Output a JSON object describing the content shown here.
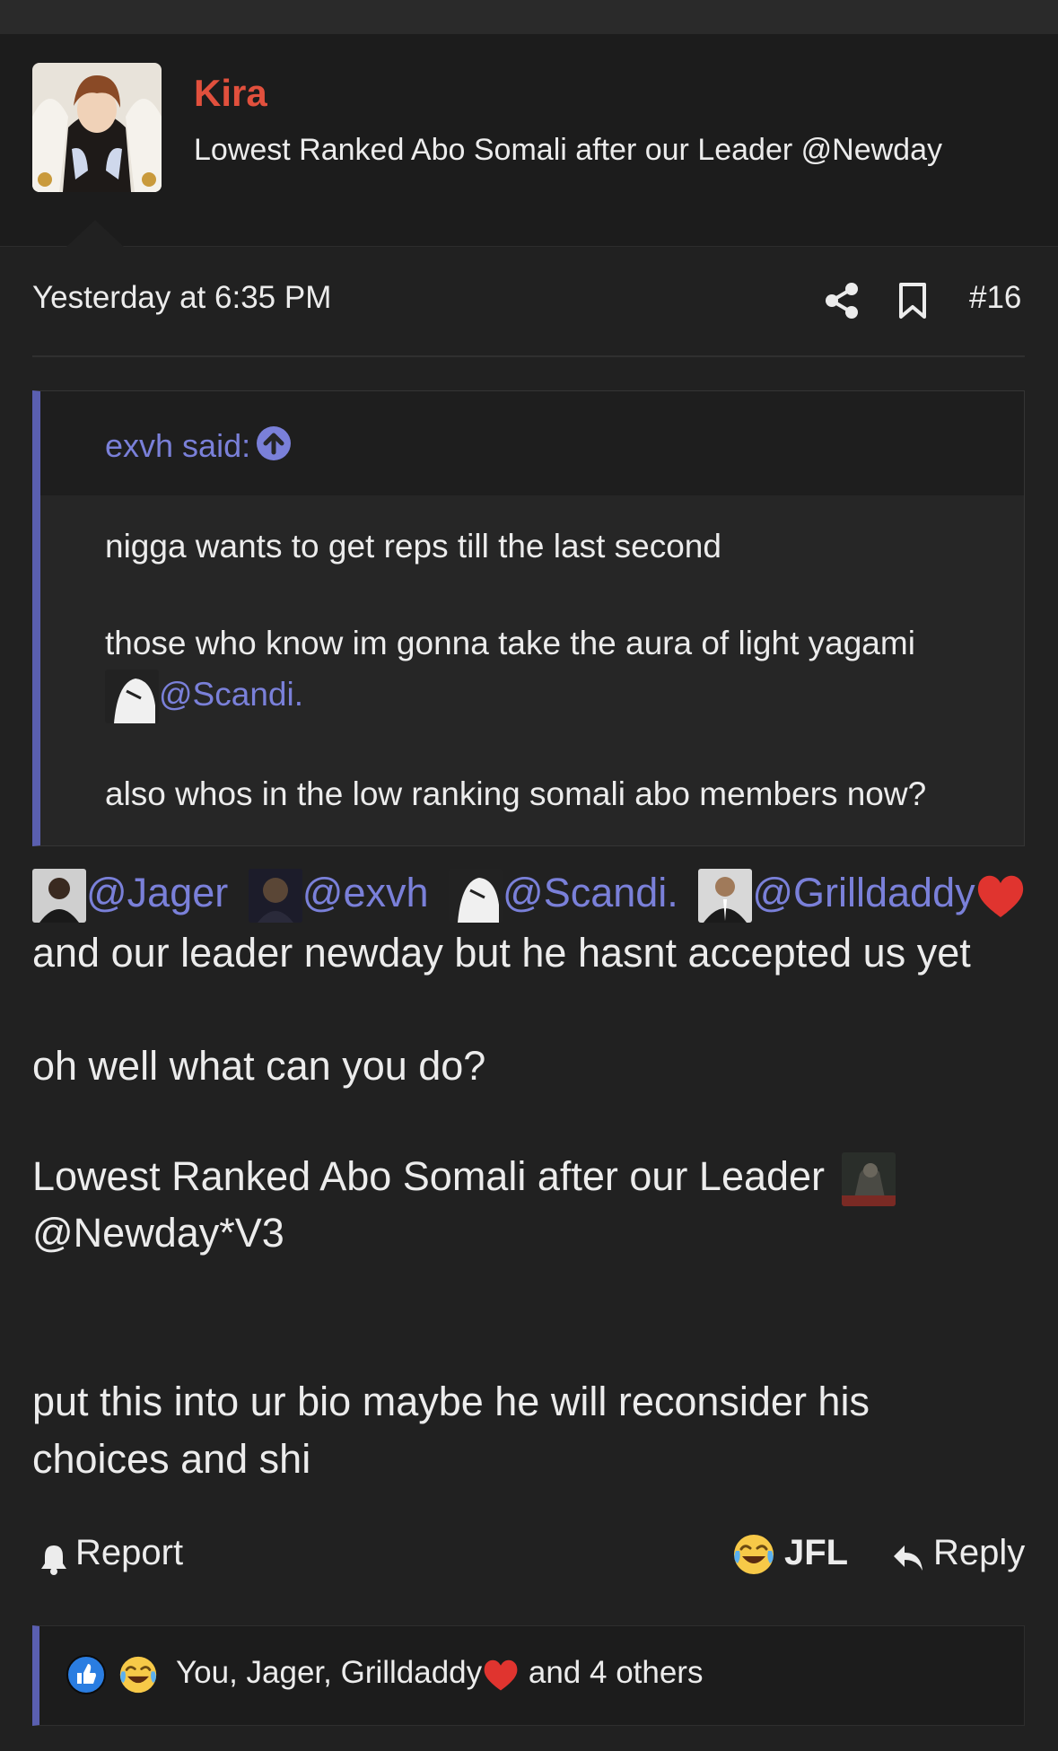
{
  "post": {
    "author": "Kira",
    "author_title": "Lowest Ranked Abo Somali after our Leader @Newday",
    "timestamp": "Yesterday at 6:35 PM",
    "post_number": "#16"
  },
  "quote": {
    "author": "exvh said:",
    "lines": [
      "nigga wants to get reps till the last second",
      "those who know im gonna take the aura of light yagami",
      "@Scandi.",
      "also whos in the low ranking somali abo members now?"
    ]
  },
  "body": {
    "mentions": [
      "@Jager",
      "@exvh",
      "@Scandi.",
      "@Grilldaddy"
    ],
    "line2": "and our leader newday but he hasnt accepted us yet",
    "line3": "oh well what can you do?",
    "line4": "Lowest Ranked Abo Somali after our Leader",
    "line5_mention": "@Newday*V3",
    "line6": "put this into ur bio maybe he will reconsider his",
    "line7": "choices and shi"
  },
  "actions": {
    "report_label": "Report",
    "reaction_label": "JFL",
    "reply_label": "Reply"
  },
  "reactions": {
    "prefix": "You, Jager, Grilldaddy",
    "suffix": " and 4 others"
  },
  "colors": {
    "background": "#212121",
    "username": "#e1503d",
    "mention": "#7a80d9",
    "quote_bar": "#5a5fb0"
  }
}
